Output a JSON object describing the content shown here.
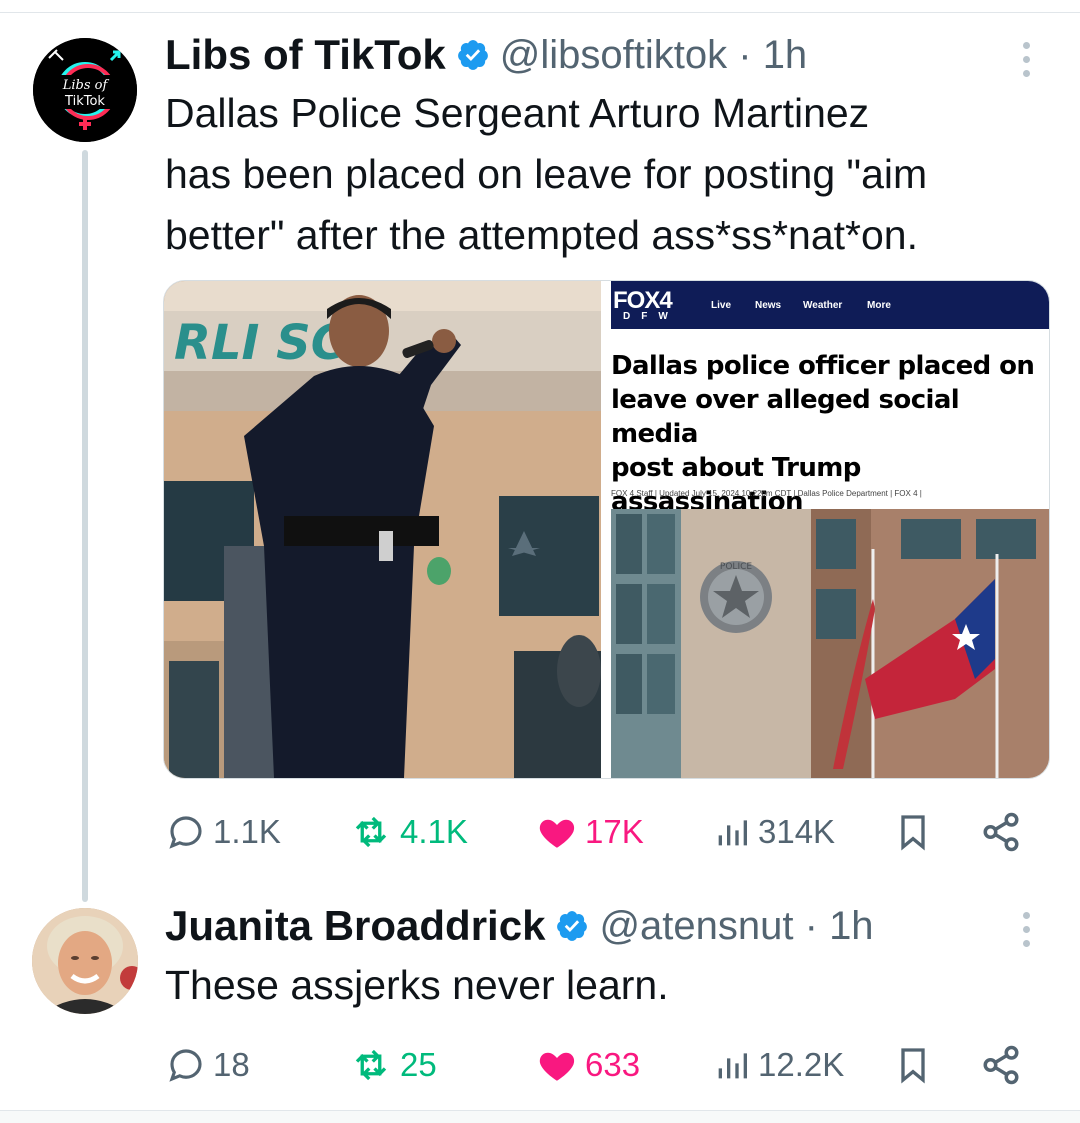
{
  "tweet1": {
    "name": "Libs of TikTok",
    "handle": "@libsoftiktok · 1h",
    "text": "Dallas Police Sergeant Arturo Martinez\nhas been placed on leave for posting \"aim\nbetter\" after the attempted ass*ss*nat*on.",
    "avatar_text_top": "Libs of",
    "avatar_text_bottom": "TikTok",
    "stats": {
      "replies": "1.1K",
      "reposts": "4.1K",
      "likes": "17K",
      "views": "314K"
    },
    "media": {
      "left_sign_text": "RLI   SCE",
      "right": {
        "logo": "FOX4",
        "logo_sub": "DFW",
        "nav": [
          "Live",
          "News",
          "Weather",
          "More"
        ],
        "headline": "Dallas police officer placed on\nleave over alleged social media\npost about Trump assassination\nattempt",
        "byline": "FOX 4 Staff  |  Updated July 15, 2024 10:22pm CDT  |  Dallas Police Department  |  FOX 4  |",
        "seal_text": "POLICE"
      }
    }
  },
  "tweet2": {
    "name": "Juanita Broaddrick",
    "handle": "@atensnut · 1h",
    "text": "These assjerks never learn.",
    "stats": {
      "replies": "18",
      "reposts": "25",
      "likes": "633",
      "views": "12.2K"
    }
  },
  "colors": {
    "verified": "#1d9bf0",
    "repost": "#00ba7c",
    "like": "#f91880",
    "muted": "#536471"
  },
  "icons": [
    "reply-icon",
    "repost-icon",
    "like-icon",
    "views-icon",
    "bookmark-icon",
    "share-icon",
    "verified-badge-icon",
    "more-options-icon"
  ]
}
